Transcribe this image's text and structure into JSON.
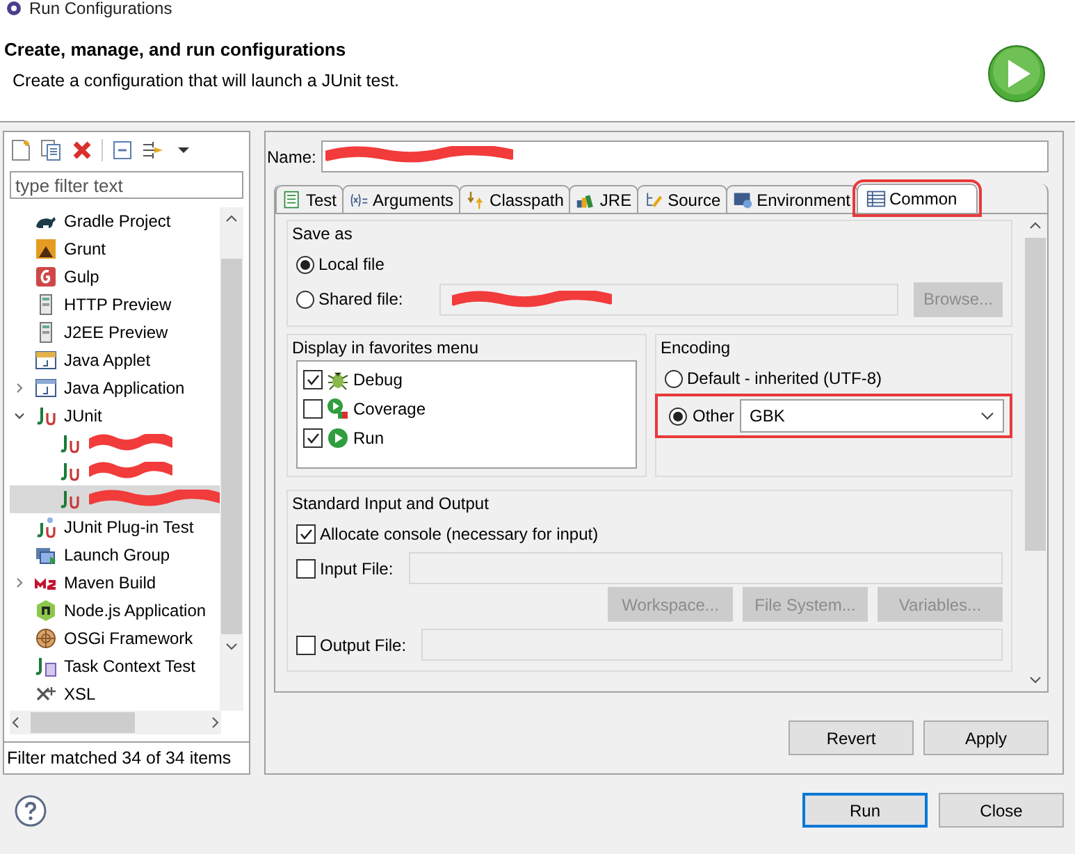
{
  "window": {
    "title": "Run Configurations"
  },
  "header": {
    "title": "Create, manage, and run configurations",
    "description": "Create a configuration that will launch a JUnit test."
  },
  "toolbar": [
    {
      "kind": "new"
    },
    {
      "kind": "duplicate"
    },
    {
      "kind": "delete"
    },
    {
      "kind": "collapse"
    },
    {
      "kind": "filter"
    },
    {
      "kind": "menu"
    }
  ],
  "filter": {
    "placeholder": "type filter text"
  },
  "tree": [
    {
      "label": "Gradle Project",
      "kind": "gradle",
      "selected": false
    },
    {
      "label": "Grunt",
      "kind": "grunt",
      "selected": false
    },
    {
      "label": "Gulp",
      "kind": "gulp",
      "selected": false
    },
    {
      "label": "HTTP Preview",
      "kind": "server",
      "selected": false
    },
    {
      "label": "J2EE Preview",
      "kind": "server",
      "selected": false
    },
    {
      "label": "Java Applet",
      "kind": "applet",
      "selected": false
    },
    {
      "label": "Java Application",
      "kind": "javaapp",
      "selected": false,
      "expanded": false
    },
    {
      "label": "JUnit",
      "kind": "junit",
      "selected": false,
      "expanded": true,
      "children": [
        {
          "kind": "junit",
          "redacted": true,
          "selected": false
        },
        {
          "kind": "junit",
          "redacted": true,
          "selected": false
        },
        {
          "kind": "junit",
          "redacted": true,
          "selected": true
        }
      ]
    },
    {
      "label": "JUnit Plug-in Test",
      "kind": "junitplugin",
      "selected": false
    },
    {
      "label": "Launch Group",
      "kind": "launch",
      "selected": false
    },
    {
      "label": "Maven Build",
      "kind": "maven",
      "selected": false,
      "expanded": false
    },
    {
      "label": "Node.js Application",
      "kind": "node",
      "selected": false
    },
    {
      "label": "OSGi Framework",
      "kind": "osgi",
      "selected": false
    },
    {
      "label": "Task Context Test",
      "kind": "task",
      "selected": false
    },
    {
      "label": "XSL",
      "kind": "xsl",
      "selected": false
    }
  ],
  "status": "Filter matched 34 of 34 items",
  "name_field": {
    "label": "Name:",
    "redacted": true
  },
  "tabs": [
    {
      "label": "Test",
      "kind": "test",
      "selected": false,
      "highlighted": false
    },
    {
      "label": "Arguments",
      "kind": "args",
      "selected": false,
      "highlighted": false
    },
    {
      "label": "Classpath",
      "kind": "classpath",
      "selected": false,
      "highlighted": false
    },
    {
      "label": "JRE",
      "kind": "jre",
      "selected": false,
      "highlighted": false
    },
    {
      "label": "Source",
      "kind": "source",
      "selected": false,
      "highlighted": false
    },
    {
      "label": "Environment",
      "kind": "env",
      "selected": false,
      "highlighted": false
    },
    {
      "label": "Common",
      "kind": "common",
      "selected": true,
      "highlighted": true
    }
  ],
  "save_as": {
    "title": "Save as",
    "options": [
      {
        "label": "Local file",
        "selected": true
      },
      {
        "label": "Shared file:",
        "selected": false,
        "redacted": true
      }
    ],
    "browse": {
      "label": "Browse...",
      "disabled": true
    }
  },
  "favorites": {
    "title": "Display in favorites menu",
    "items": [
      {
        "label": "Debug",
        "kind": "debug",
        "checked": true
      },
      {
        "label": "Coverage",
        "kind": "coverage",
        "checked": false
      },
      {
        "label": "Run",
        "kind": "run",
        "checked": true
      }
    ]
  },
  "encoding": {
    "title": "Encoding",
    "default": {
      "label": "Default - inherited (UTF-8)",
      "selected": false
    },
    "other": {
      "label": "Other",
      "selected": true,
      "value": "GBK",
      "highlighted": true
    }
  },
  "stdio": {
    "title": "Standard Input and Output",
    "allocate": {
      "label": "Allocate console (necessary for input)",
      "checked": true
    },
    "input": {
      "label": "Input File:",
      "checked": false
    },
    "input_buttons": [
      {
        "label": "Workspace...",
        "disabled": true
      },
      {
        "label": "File System...",
        "disabled": true
      },
      {
        "label": "Variables...",
        "disabled": true
      }
    ],
    "output": {
      "label": "Output File:",
      "checked": false
    }
  },
  "panel_buttons": [
    {
      "label": "Revert",
      "default": false
    },
    {
      "label": "Apply",
      "default": false
    }
  ],
  "dialog_buttons": [
    {
      "label": "Run",
      "default": true
    },
    {
      "label": "Close",
      "default": false
    }
  ]
}
